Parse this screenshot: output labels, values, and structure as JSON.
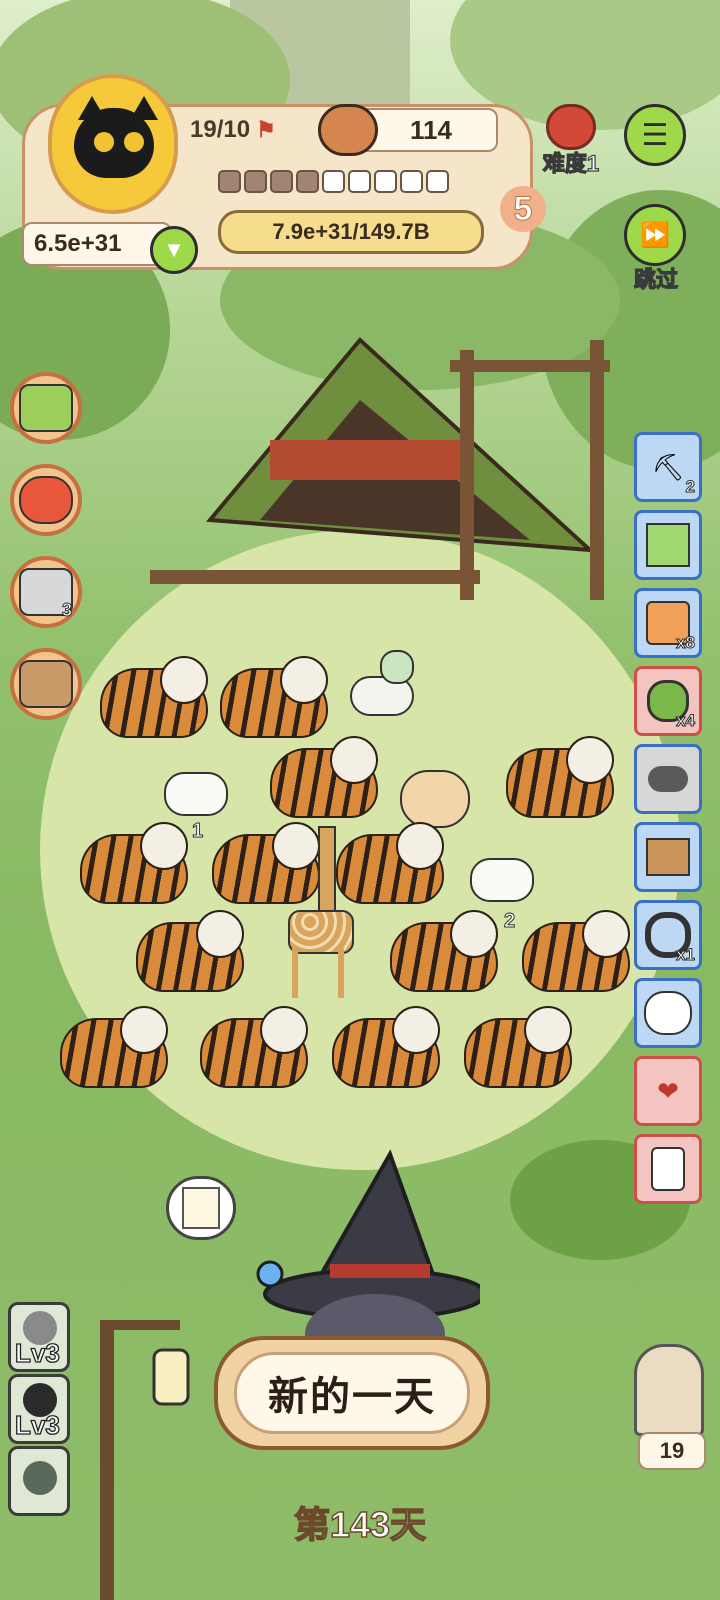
{
  "hud": {
    "tiles_count": "19/10",
    "food_count": "114",
    "power_value": "6.5e+31",
    "level_number": "5",
    "progress_text": "7.9e+31/149.7B",
    "segments_filled": 4,
    "segments_total": 9
  },
  "difficulty_label": "难度1",
  "skip_label": "跳过",
  "left_buttons": [
    {
      "name": "medkit-button",
      "badge": ""
    },
    {
      "name": "fish-button",
      "badge": ""
    },
    {
      "name": "scroll-timer-button",
      "badge": "3"
    },
    {
      "name": "box-button",
      "badge": ""
    }
  ],
  "right_items": [
    {
      "icon": "shovel-icon",
      "color": "blue",
      "count": "2"
    },
    {
      "icon": "ticket-icon",
      "color": "blue",
      "count": ""
    },
    {
      "icon": "refresh-ticket-icon",
      "color": "blue",
      "count": "x8"
    },
    {
      "icon": "medal-icon",
      "color": "red",
      "count": "x4"
    },
    {
      "icon": "horn-icon",
      "color": "blue",
      "count": ""
    },
    {
      "icon": "treasure-chest-icon",
      "color": "blue",
      "count": ""
    },
    {
      "icon": "ring-icon",
      "color": "blue",
      "count": "x1"
    },
    {
      "icon": "sheep-icon",
      "color": "blue",
      "count": ""
    },
    {
      "icon": "heart-bag-icon",
      "color": "red",
      "count": ""
    },
    {
      "icon": "jar-icon",
      "color": "red",
      "count": ""
    }
  ],
  "animal_badges": {
    "sheep_left": "1",
    "sheep_right": "2"
  },
  "levels": [
    "Lv3",
    "Lv3",
    ""
  ],
  "owl_count": "19",
  "new_day_label": "新的一天",
  "day_label": "第143天",
  "colors": {
    "accent_green": "#9fd848",
    "panel_blue": "#3a6fc8",
    "panel_red": "#d14f4a",
    "hud_border": "#c9906a"
  }
}
